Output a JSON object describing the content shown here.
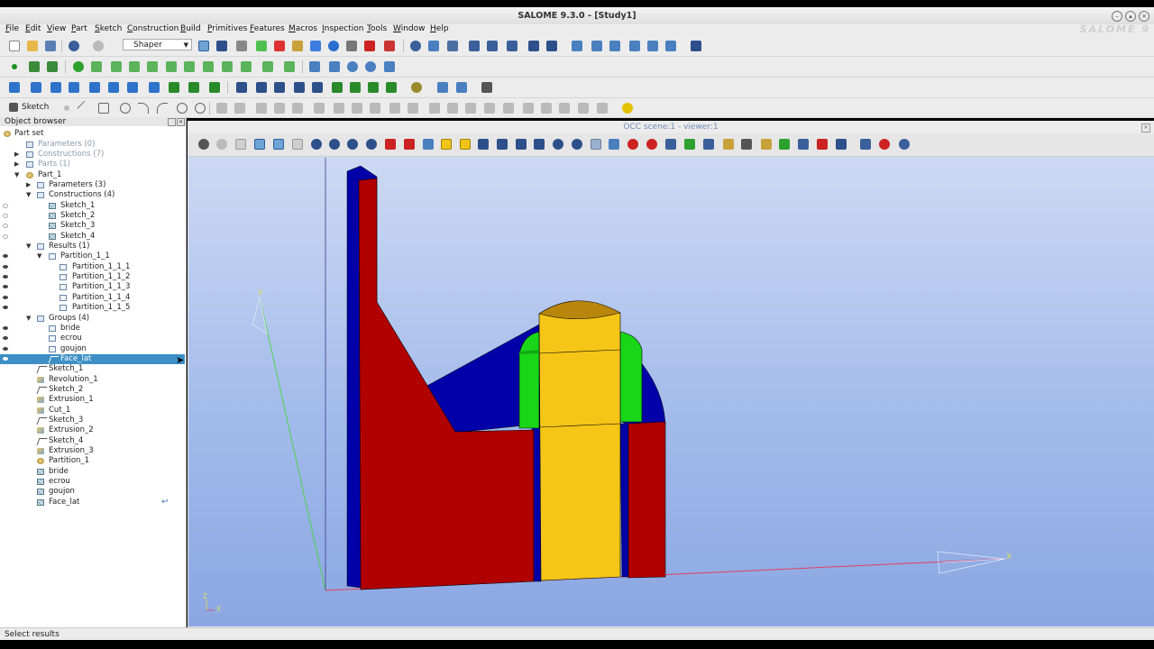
{
  "window": {
    "title": "SALOME  9.3.0 - [Study1]",
    "watermark": "SALOME 9"
  },
  "menu": [
    "File",
    "Edit",
    "View",
    "Part",
    "Sketch",
    "Construction",
    "Build",
    "Primitives",
    "Features",
    "Macros",
    "Inspection",
    "Tools",
    "Window",
    "Help"
  ],
  "toolbar": {
    "module_combo": "Shaper",
    "sketch_button": "Sketch"
  },
  "object_browser": {
    "title": "Object browser",
    "root": "Part set",
    "items": [
      {
        "label": "Parameters (0)",
        "faded": true
      },
      {
        "label": "Constructions (7)",
        "faded": true
      },
      {
        "label": "Parts (1)",
        "faded": true
      },
      {
        "label": "Part_1"
      },
      {
        "label": "Parameters (3)"
      },
      {
        "label": "Constructions (4)"
      },
      {
        "label": "Sketch_1"
      },
      {
        "label": "Sketch_2"
      },
      {
        "label": "Sketch_3"
      },
      {
        "label": "Sketch_4"
      },
      {
        "label": "Results (1)"
      },
      {
        "label": "Partition_1_1"
      },
      {
        "label": "Partition_1_1_1"
      },
      {
        "label": "Partition_1_1_2"
      },
      {
        "label": "Partition_1_1_3"
      },
      {
        "label": "Partition_1_1_4"
      },
      {
        "label": "Partition_1_1_5"
      },
      {
        "label": "Groups (4)"
      },
      {
        "label": "bride"
      },
      {
        "label": "ecrou"
      },
      {
        "label": "goujon"
      },
      {
        "label": "Face_lat",
        "selected": true
      },
      {
        "label": "Sketch_1"
      },
      {
        "label": "Revolution_1"
      },
      {
        "label": "Sketch_2"
      },
      {
        "label": "Extrusion_1"
      },
      {
        "label": "Cut_1"
      },
      {
        "label": "Sketch_3"
      },
      {
        "label": "Extrusion_2"
      },
      {
        "label": "Sketch_4"
      },
      {
        "label": "Extrusion_3"
      },
      {
        "label": "Partition_1"
      },
      {
        "label": "bride"
      },
      {
        "label": "ecrou"
      },
      {
        "label": "goujon"
      },
      {
        "label": "Face_lat"
      }
    ]
  },
  "viewer": {
    "title": "OCC scene:1 - viewer:1",
    "axes": {
      "x": "X",
      "y": "Y",
      "z": "Z"
    },
    "colors": {
      "red": "#b00000",
      "blue": "#0000a8",
      "yellow": "#f5c518",
      "green": "#19d619",
      "brown": "#b8860b"
    }
  },
  "status": {
    "text": "Select results"
  }
}
